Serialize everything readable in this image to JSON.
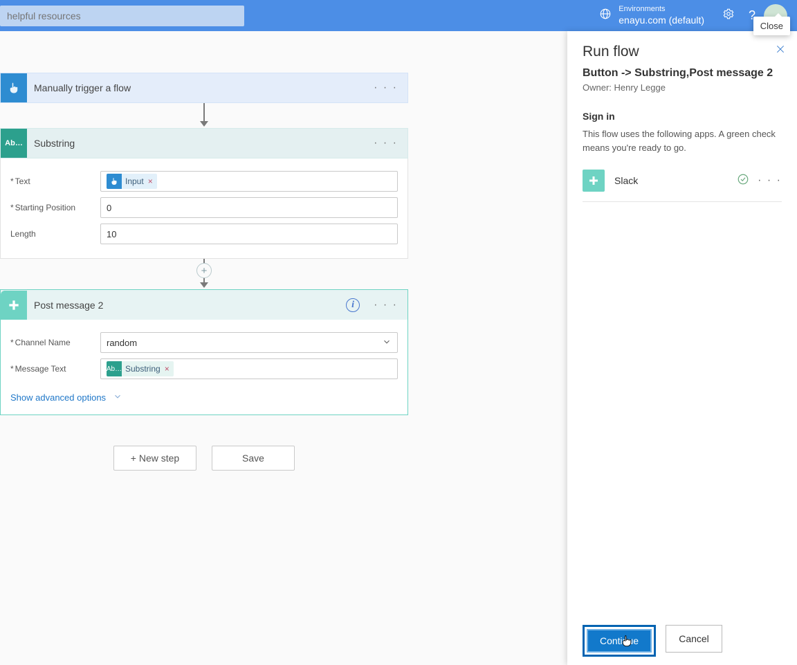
{
  "header": {
    "search_placeholder": "helpful resources",
    "env_label": "Environments",
    "env_name": "enayu.com (default)",
    "close_tooltip": "Close"
  },
  "flow": {
    "trigger": {
      "title": "Manually trigger a flow"
    },
    "substring": {
      "title": "Substring",
      "fields": {
        "text_label": "Text",
        "text_token": "Input",
        "start_label": "Starting Position",
        "start_value": "0",
        "length_label": "Length",
        "length_value": "10"
      }
    },
    "post": {
      "title": "Post message 2",
      "channel_label": "Channel Name",
      "channel_value": "random",
      "msg_label": "Message Text",
      "msg_token": "Substring",
      "advanced": "Show advanced options"
    },
    "buttons": {
      "new_step": "+ New step",
      "save": "Save"
    }
  },
  "panel": {
    "title": "Run flow",
    "flow_name": "Button -> Substring,Post message 2",
    "owner": "Owner: Henry Legge",
    "signin": "Sign in",
    "description": "This flow uses the following apps. A green check means you're ready to go.",
    "connection": "Slack",
    "continue": "Continue",
    "cancel": "Cancel"
  }
}
